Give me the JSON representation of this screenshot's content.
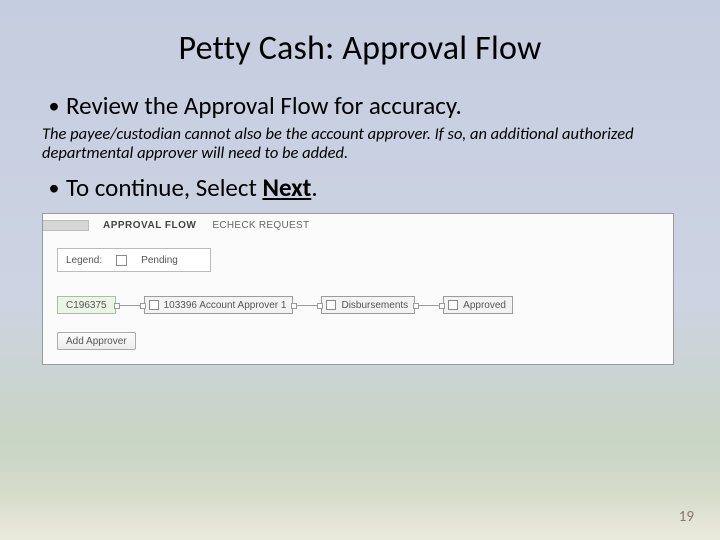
{
  "title": "Petty Cash: Approval Flow",
  "bullets": {
    "b1": "Review the Approval Flow for accuracy.",
    "note": "The payee/custodian cannot also be the account approver. If so, an additional authorized departmental approver will need to be added.",
    "b2_pre": "To continue, Select ",
    "b2_key": "Next",
    "b2_post": "."
  },
  "panel": {
    "heading": "APPROVAL FLOW",
    "subheading": "ECHECK REQUEST",
    "legend_label": "Legend:",
    "legend_pending": "Pending",
    "flow": {
      "start": "C196375",
      "n1": "103396 Account Approver 1",
      "n2": "Disbursements",
      "n3": "Approved"
    },
    "add_button": "Add Approver"
  },
  "pagenum": "19"
}
